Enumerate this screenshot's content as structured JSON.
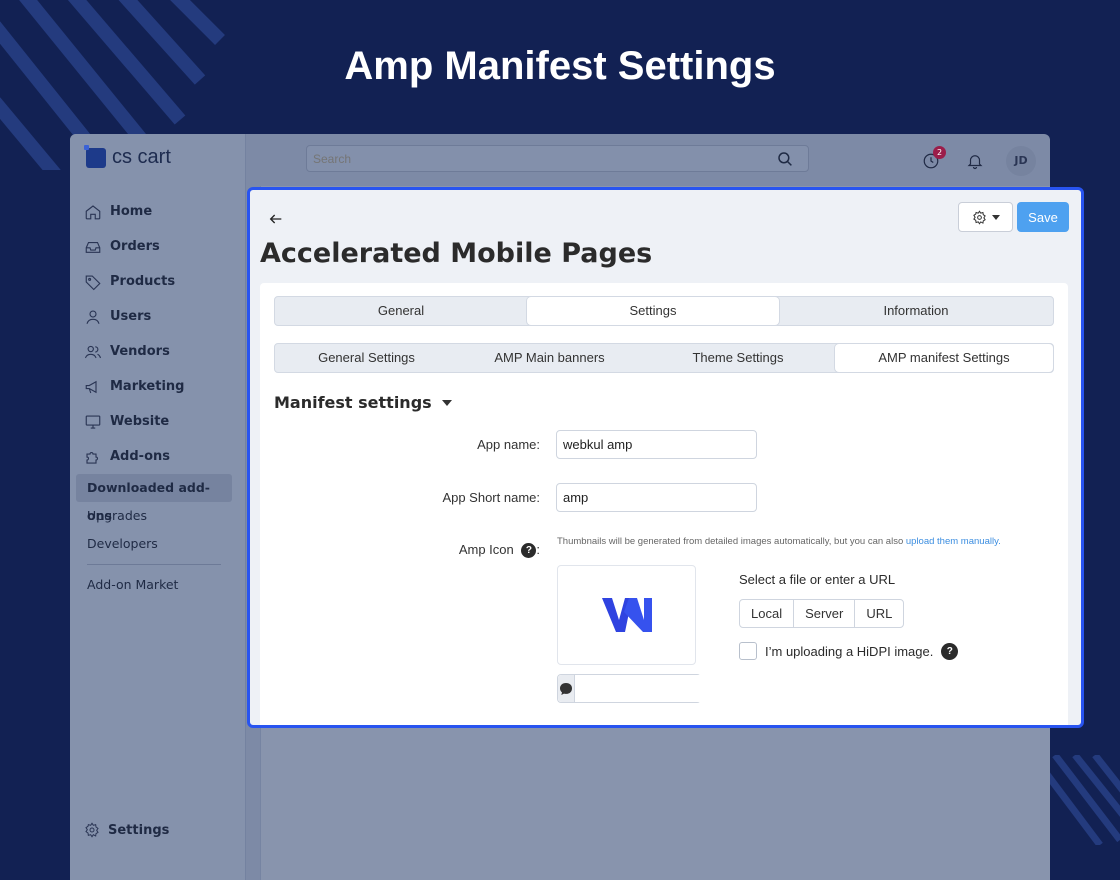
{
  "banner": {
    "title": "Amp Manifest Settings"
  },
  "colors": {
    "background": "#122153",
    "highlight": "#2854f0",
    "save": "#4ea1f0",
    "link": "#3c8ee0"
  },
  "app": {
    "logo": "cs cart",
    "search": {
      "placeholder": "Search"
    },
    "notifications_badge": "2",
    "avatar": "JD",
    "sidebar": {
      "items": [
        {
          "label": "Home",
          "icon": "home-icon"
        },
        {
          "label": "Orders",
          "icon": "inbox-icon"
        },
        {
          "label": "Products",
          "icon": "tag-icon"
        },
        {
          "label": "Users",
          "icon": "user-icon"
        },
        {
          "label": "Vendors",
          "icon": "users-icon"
        },
        {
          "label": "Marketing",
          "icon": "megaphone-icon"
        },
        {
          "label": "Website",
          "icon": "monitor-icon"
        },
        {
          "label": "Add-ons",
          "icon": "puzzle-icon"
        }
      ],
      "subitems": [
        "Downloaded add-ons",
        "Upgrades",
        "Developers"
      ],
      "market": "Add-on Market",
      "settings": "Settings"
    }
  },
  "panel": {
    "title": "Accelerated Mobile Pages",
    "save_label": "Save",
    "tabs": [
      "General",
      "Settings",
      "Information"
    ],
    "active_tab": "Settings",
    "subtabs": [
      "General Settings",
      "AMP Main banners",
      "Theme Settings",
      "AMP manifest Settings"
    ],
    "active_subtab": "AMP manifest Settings",
    "section_title": "Manifest settings",
    "fields": {
      "app_name_label": "App name:",
      "app_name_value": "webkul amp",
      "short_name_label": "App Short name:",
      "short_name_value": "amp",
      "icon_label": "Amp Icon",
      "icon_label_suffix": ":"
    },
    "hint_text": "Thumbnails will be generated from detailed images automatically, but you can also ",
    "hint_link": "upload them manually.",
    "file_select_label": "Select a file or enter a URL",
    "file_buttons": [
      "Local",
      "Server",
      "URL"
    ],
    "hidpi_label": "I’m uploading a HiDPI image."
  }
}
